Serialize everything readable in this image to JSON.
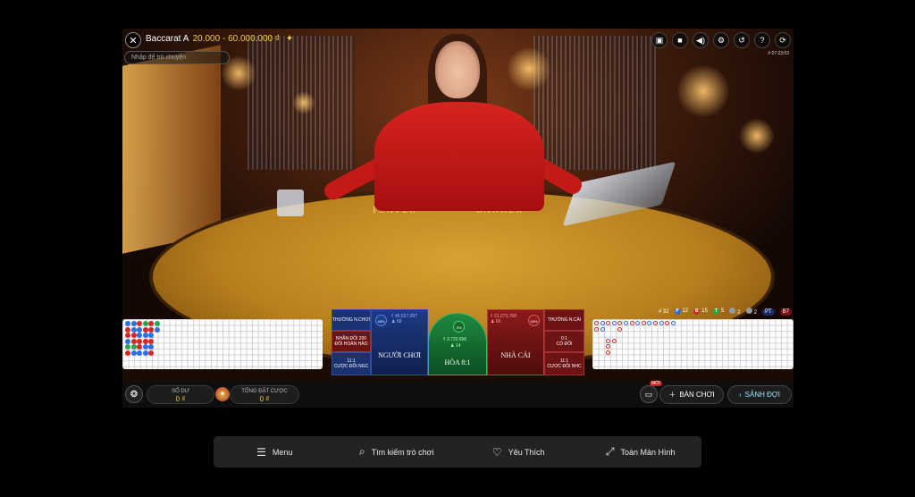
{
  "game": {
    "title": "Baccarat A",
    "limits": "20.000 - 60.000.000 ₫",
    "star": "✦",
    "chat_placeholder": "Nhập để trò chuyện",
    "game_id": "# 07:23:03"
  },
  "table_print": {
    "player": "PLAYER",
    "banker": "BANKER"
  },
  "top_icons": [
    {
      "name": "chat-icon",
      "glyph": "▣"
    },
    {
      "name": "video-icon",
      "glyph": "■"
    },
    {
      "name": "volume-icon",
      "glyph": "◀)"
    },
    {
      "name": "settings-icon",
      "glyph": "⚙"
    },
    {
      "name": "history-icon",
      "glyph": "↺"
    },
    {
      "name": "help-icon",
      "glyph": "?"
    },
    {
      "name": "reload-icon",
      "glyph": "⟳"
    }
  ],
  "stats": {
    "rounds": "# 32",
    "player_letter": "P",
    "player_count": "12",
    "banker_letter": "B",
    "banker_count": "15",
    "tie_letter": "T",
    "tie_count": "5",
    "pair_a": "2",
    "pair_b": "2",
    "p_pill": "PT",
    "b_pill": "B7",
    "colors": {
      "player": "#2c6ee6",
      "banker": "#d82525",
      "tie": "#23a94a"
    }
  },
  "bets": {
    "player_pair": "THƯỜNG N.CHƠI",
    "either_pair": "NHÂN ĐÔI 200 ĐÔI HOÀN HẢO",
    "player_bonus_odds": "11:1",
    "player_bonus": "CƯỢC ĐÔI NGC",
    "player_label": "NGƯỜI CHƠI",
    "player_amount": "₫ 45.527.287",
    "player_people": "♟ 68",
    "player_pct": "45%",
    "tie_label": "HÒA 8:1",
    "tie_amount": "₫ 3.720.896",
    "tie_people": "♟ 14",
    "tie_pct": "5%",
    "banker_label": "NHÀ CÁI",
    "banker_amount": "₫ 21.273.768",
    "banker_people": "♟ 65",
    "banker_pct": "50%",
    "banker_pair": "THƯỜNG N.CÁI",
    "perfect_odds": "0:1",
    "perfect": "CÓ ĐÔI",
    "banker_bonus_odds": "11:1",
    "banker_bonus": "CƯỢC ĐÔI NHC"
  },
  "wallet": {
    "balance_label": "SỐ DƯ",
    "balance_value": "0 ₫",
    "total_bet_label": "TỔNG ĐẶT CƯỢC",
    "total_bet_value": "0 ₫"
  },
  "actions": {
    "new_badge": "MỚI",
    "more_tables": "BÀN CHƠI",
    "lobby": "SẢNH ĐỢI"
  },
  "footer": [
    {
      "label": "Menu",
      "icon": "☰",
      "icon_name": "menu-icon"
    },
    {
      "label": "Tìm kiếm trò chơi",
      "icon": "⌕",
      "icon_name": "search-icon"
    },
    {
      "label": "Yêu Thích",
      "icon": "♡",
      "icon_name": "heart-icon"
    },
    {
      "label": "Toàn Màn Hình",
      "icon": "⤢",
      "icon_name": "fullscreen-icon"
    }
  ]
}
